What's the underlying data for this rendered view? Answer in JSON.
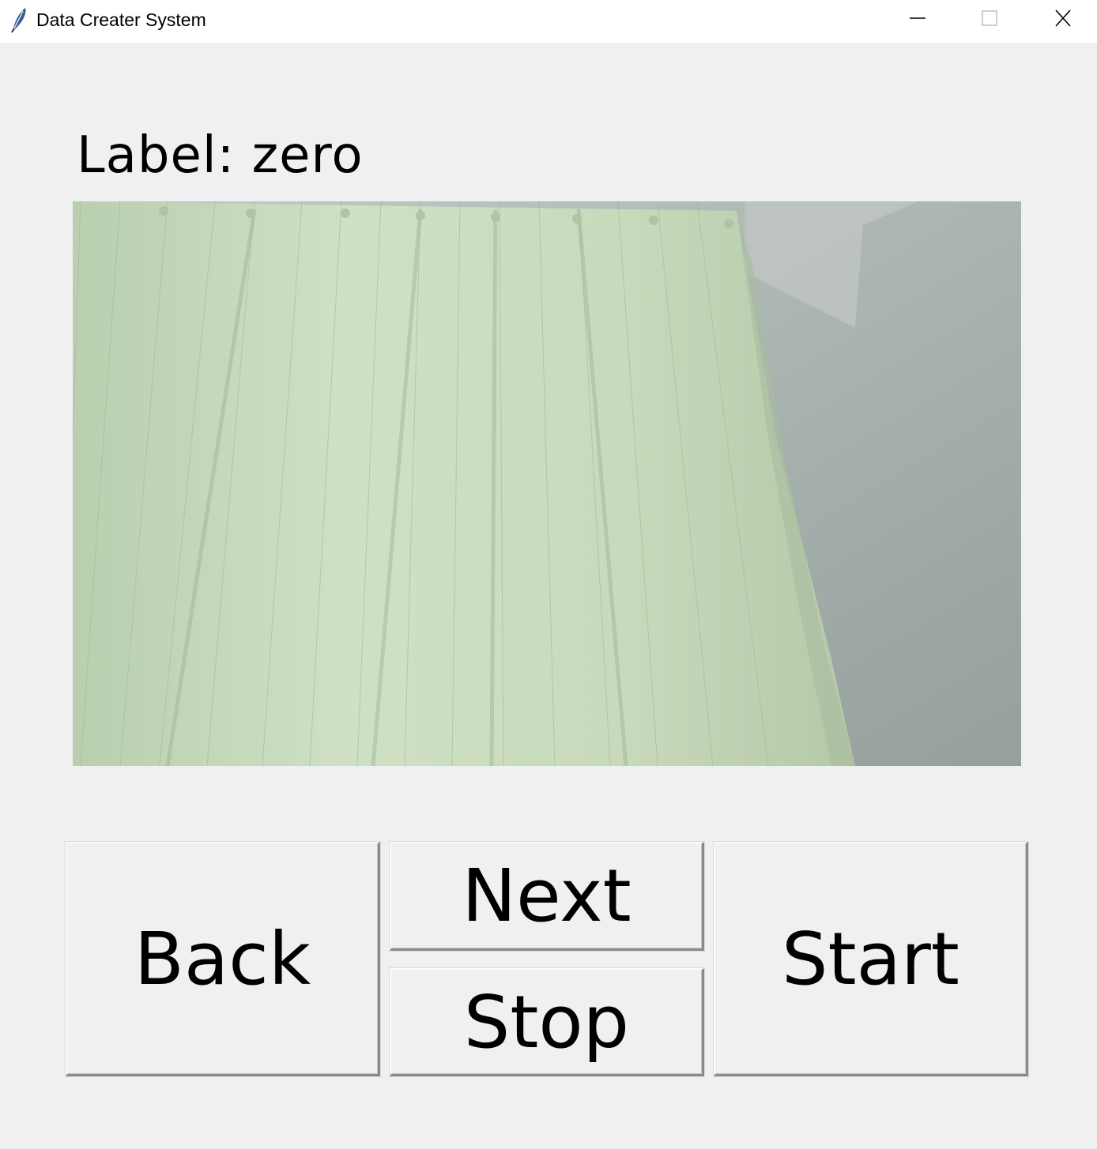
{
  "window": {
    "title": "Data Creater System",
    "app_icon": "feather-icon",
    "controls": [
      "minimize-icon",
      "maximize-icon",
      "close-icon"
    ]
  },
  "label": {
    "text": "Label: zero"
  },
  "camera": {
    "content": "live camera frame"
  },
  "buttons": {
    "back": "Back",
    "next": "Next",
    "stop": "Stop",
    "start": "Start"
  },
  "colors": {
    "background": "#f0f0f0",
    "titlebar": "#ffffff",
    "curtain": "#c9dcbf",
    "wall": "#a9b3b0"
  }
}
